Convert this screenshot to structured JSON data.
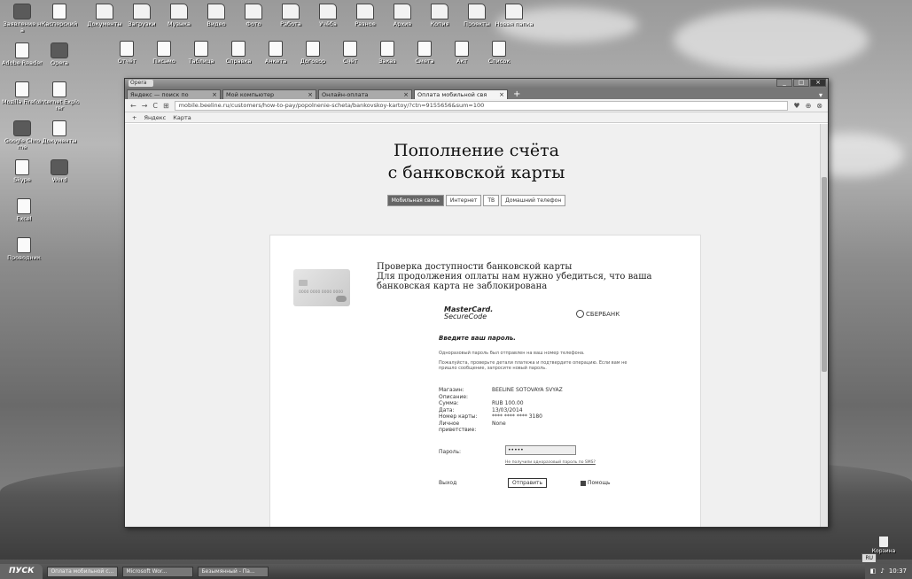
{
  "desktop": {
    "icons_left": [
      {
        "label": "Заявление на"
      },
      {
        "label": "Касперский"
      },
      {
        "label": "Adobe Reader"
      },
      {
        "label": "Opera"
      },
      {
        "label": "Mozilla Firefox"
      },
      {
        "label": "Internet Explorer"
      },
      {
        "label": "Google Chrome"
      },
      {
        "label": "Документы"
      },
      {
        "label": "Skype"
      },
      {
        "label": "Word"
      },
      {
        "label": "Excel"
      },
      {
        "label": "Проводник"
      }
    ],
    "icons_top_row1": [
      "Документы",
      "Загрузки",
      "Музыка",
      "Видео",
      "Фото",
      "Работа",
      "Учёба",
      "Разное",
      "Архив",
      "Копия",
      "Проекты",
      "Новая папка"
    ],
    "icons_top_row2": [
      "Отчёт",
      "Письмо",
      "Таблица",
      "Справка",
      "Анкета",
      "Договор",
      "Счёт",
      "Заказ",
      "Смета",
      "Акт",
      "Список"
    ],
    "recycle_bin": "Корзина",
    "language": "RU"
  },
  "browser": {
    "app_name": "Opera",
    "tabs": [
      {
        "label": "Яндекс — поиск по",
        "active": false
      },
      {
        "label": "Мой компьютер",
        "active": false
      },
      {
        "label": "Онлайн-оплата",
        "active": false
      },
      {
        "label": "Оплата мобильной свя",
        "active": true
      }
    ],
    "new_tab": "+",
    "url": "mobile.beeline.ru/customers/how-to-pay/popolnenie-scheta/bankovskoy-kartoy/?ctn=9155656&sum=100",
    "bookmarks": [
      "Яндекс",
      "Карта"
    ],
    "nav": {
      "back": "←",
      "forward": "→",
      "reload": "C"
    }
  },
  "page": {
    "title_line1": "Пополнение счёта",
    "title_line2": "с банковской карты",
    "payment_tabs": [
      {
        "label": "Мобильная связь",
        "active": true
      },
      {
        "label": "Интернет",
        "active": false
      },
      {
        "label": "ТВ",
        "active": false
      },
      {
        "label": "Домашний телефон",
        "active": false
      }
    ],
    "card": {
      "number": "0000 0000 0000 0000",
      "holder": "IVANOV IVAN"
    },
    "verify_heading": "Проверка доступности банковской карты",
    "verify_text": "Для продолжения оплаты нам нужно убедиться, что ваша банковская карта не заблокирована",
    "mastercard": {
      "line1": "MasterCard.",
      "line2": "SecureCode"
    },
    "bank_name": "СБЕРБАНК",
    "enter_password": "Введите ваш пароль.",
    "fine_print_1": "Одноразовый пароль был отправлен на ваш номер телефона.",
    "fine_print_2": "Пожалуйста, проверьте детали платежа и подтвердите операцию. Если вам не пришло сообщение, запросите новый пароль.",
    "details": [
      {
        "key": "Магазин:",
        "value": "BEELINE SOTOVAYA SVYAZ"
      },
      {
        "key": "Описание:",
        "value": ""
      },
      {
        "key": "Сумма:",
        "value": "RUB 100.00"
      },
      {
        "key": "Дата:",
        "value": "13/03/2014"
      },
      {
        "key": "Номер карты:",
        "value": "**** **** **** 3180"
      },
      {
        "key": "Личное приветствие:",
        "value": "None"
      }
    ],
    "password_label": "Пароль:",
    "password_value": "•••••",
    "password_link": "Не получили одноразовый пароль по SMS?",
    "exit_label": "Выход",
    "confirm_label": "Отправить",
    "help_label": "Помощь"
  },
  "taskbar": {
    "start": "ПУСК",
    "tasks": [
      {
        "label": "Оплата мобильной с...",
        "active": true
      },
      {
        "label": "Microsoft Wor...",
        "active": false
      },
      {
        "label": "Безымянный - Па...",
        "active": false
      }
    ],
    "clock": "10:37"
  }
}
